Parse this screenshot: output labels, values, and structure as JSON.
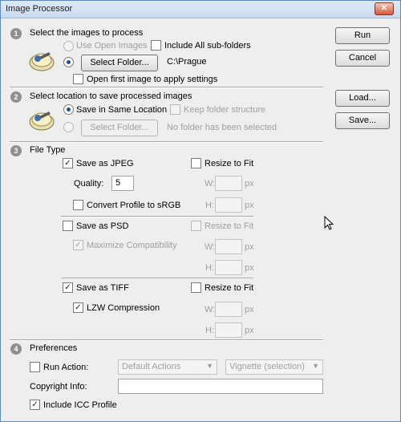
{
  "window": {
    "title": "Image Processor",
    "close_glyph": "✕"
  },
  "actions": {
    "run": "Run",
    "cancel": "Cancel",
    "load": "Load...",
    "save": "Save..."
  },
  "section1": {
    "number": "1",
    "heading": "Select the images to process",
    "use_open_images": "Use Open Images",
    "include_subfolders": "Include All sub-folders",
    "select_folder": "Select Folder...",
    "folder_path": "C:\\Prague",
    "open_first": "Open first image to apply settings"
  },
  "section2": {
    "number": "2",
    "heading": "Select location to save processed images",
    "save_same": "Save in Same Location",
    "keep_structure": "Keep folder structure",
    "select_folder": "Select Folder...",
    "no_folder": "No folder has been selected"
  },
  "section3": {
    "number": "3",
    "heading": "File Type",
    "jpeg": {
      "save_label": "Save as JPEG",
      "resize": "Resize to Fit",
      "quality_label": "Quality:",
      "quality_value": "5",
      "convert": "Convert Profile to sRGB",
      "w": "W:",
      "h": "H:",
      "px": "px"
    },
    "psd": {
      "save_label": "Save as PSD",
      "resize": "Resize to Fit",
      "maximize": "Maximize Compatibility",
      "w": "W:",
      "h": "H:",
      "px": "px"
    },
    "tiff": {
      "save_label": "Save as TIFF",
      "resize": "Resize to Fit",
      "lzw": "LZW Compression",
      "w": "W:",
      "h": "H:",
      "px": "px"
    }
  },
  "section4": {
    "number": "4",
    "heading": "Preferences",
    "run_action": "Run Action:",
    "action_set": "Default Actions",
    "action_name": "Vignette (selection)",
    "copyright": "Copyright Info:",
    "copyright_value": "",
    "icc": "Include ICC Profile"
  },
  "check_glyph": "✓",
  "dropdown_glyph": "▼"
}
